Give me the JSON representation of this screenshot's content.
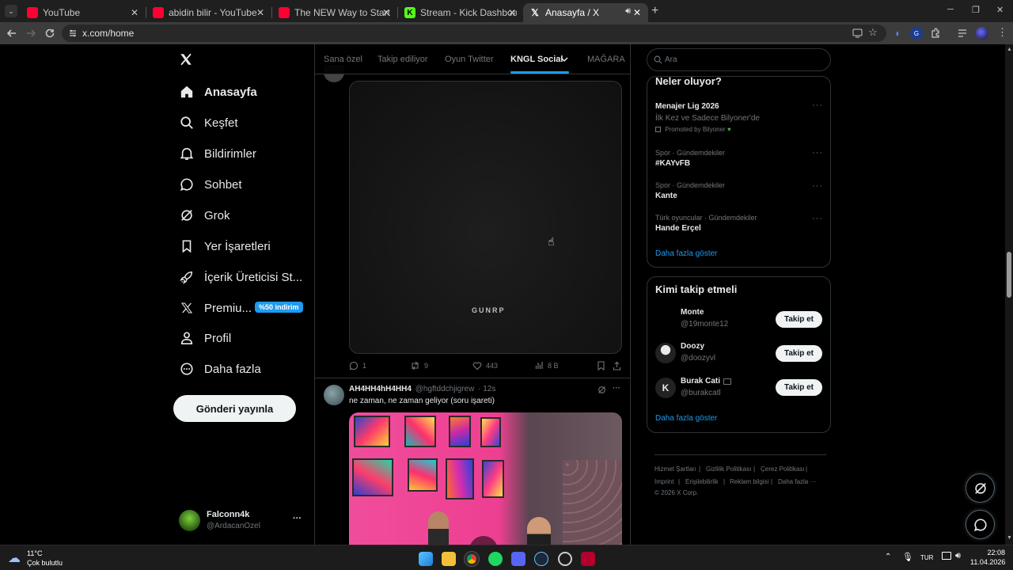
{
  "browser": {
    "tabs": [
      {
        "label": "YouTube",
        "favicon_color": "#ff0033"
      },
      {
        "label": "abidin bilir - YouTube",
        "favicon_color": "#ff0033"
      },
      {
        "label": "The NEW Way to Start a Succe",
        "favicon_color": "#ff0033"
      },
      {
        "label": "Stream - Kick Dashboard",
        "favicon_color": "#53fc18"
      },
      {
        "label": "Anasayfa / X",
        "favicon_color": "#ffffff"
      }
    ],
    "url": "x.com/home",
    "window_buttons": {
      "minimize": "─",
      "restore": "❐",
      "close": "✕"
    },
    "new_tab": "+"
  },
  "sidebar": {
    "logo": "X",
    "items": [
      {
        "label": "Anasayfa",
        "icon": "home-icon"
      },
      {
        "label": "Keşfet",
        "icon": "search-icon"
      },
      {
        "label": "Bildirimler",
        "icon": "bell-icon"
      },
      {
        "label": "Sohbet",
        "icon": "chat-icon"
      },
      {
        "label": "Grok",
        "icon": "grok-icon"
      },
      {
        "label": "Yer İşaretleri",
        "icon": "bookmark-icon"
      },
      {
        "label": "İçerik Üreticisi St...",
        "icon": "rocket-icon"
      },
      {
        "label": "Premiu...",
        "icon": "x-icon"
      },
      {
        "label": "Profil",
        "icon": "person-icon"
      },
      {
        "label": "Daha fazla",
        "icon": "more-circle-icon"
      }
    ],
    "premium_badge": "%50 indirim",
    "post_button": "Gönderi yayınla",
    "account": {
      "name": "Falconn4k",
      "handle": "@ArdacanOzel",
      "more": "···"
    }
  },
  "timeline": {
    "tabs": [
      "Sana özel",
      "Takip ediliyor",
      "Oyun Twitter",
      "KNGL Social",
      "MAĞARA"
    ],
    "selected_tab": "KNGL Social",
    "post1": {
      "image_watermark": "GUNRP",
      "actions": {
        "replies": "1",
        "reposts": "9",
        "likes": "443",
        "views": "8 B"
      }
    },
    "post2": {
      "name": "AH4HH4hH4HH4",
      "handle": "@hgftddchjigrew",
      "time": "· 12s",
      "text": "ne zaman, ne zaman geliyor (soru işareti)"
    }
  },
  "right": {
    "search_placeholder": "Ara",
    "trends_title": "Neler oluyor?",
    "trends": [
      {
        "meta": "",
        "title": "Menajer Lig 2026",
        "subtitle": "İlk Kez ve Sadece Bilyoner'de",
        "promo": "Promoted by Bilyoner"
      },
      {
        "meta": "Spor · Gündemdekiler",
        "title": "#KAYvFB"
      },
      {
        "meta": "Spor · Gündemdekiler",
        "title": "Kante"
      },
      {
        "meta": "Türk oyuncular · Gündemdekiler",
        "title": "Hande Erçel"
      }
    ],
    "trends_more": "Daha fazla göster",
    "who_title": "Kimi takip etmeli",
    "who": [
      {
        "name": "Monte",
        "handle": "@19monte12"
      },
      {
        "name": "Doozy",
        "handle": "@doozyvl"
      },
      {
        "name": "Burak Cati",
        "handle": "@burakcatl"
      }
    ],
    "follow_label": "Takip et",
    "who_more": "Daha fazla göster",
    "footer": {
      "links1": [
        "Hizmet Şartları",
        "Gizlilik Politikası",
        "Çerez Politikası"
      ],
      "links2": [
        "Imprint",
        "Erişilebilirlik",
        "Reklam bilgisi",
        "Daha fazla ···"
      ],
      "copyright": "© 2026 X Corp."
    }
  },
  "taskbar": {
    "weather_temp": "11°C",
    "weather_text": "Çok bulutlu",
    "lang": "TUR",
    "time": "22:08",
    "date": "11.04.2026"
  }
}
